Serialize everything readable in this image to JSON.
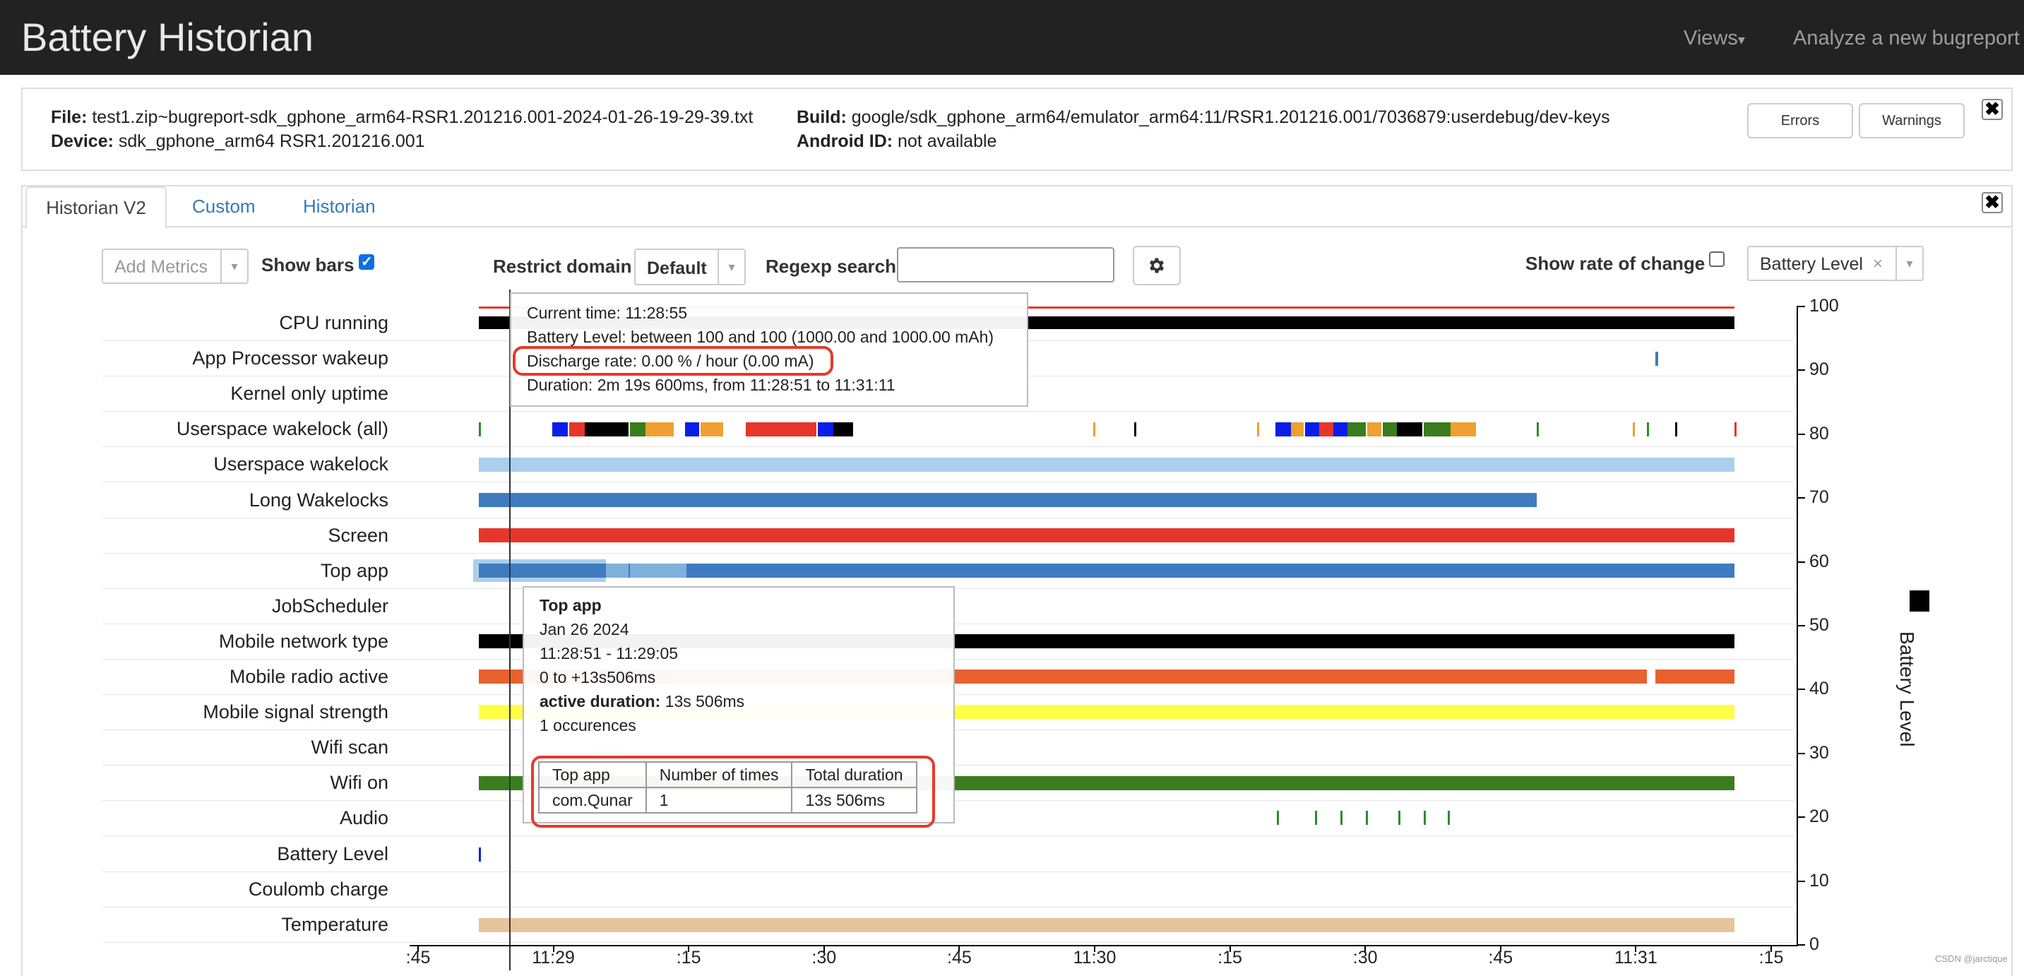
{
  "navbar": {
    "title": "Battery Historian",
    "views_label": "Views",
    "analyze_label": "Analyze a new bugreport"
  },
  "file_info": {
    "file_label": "File:",
    "file_value": "test1.zip~bugreport-sdk_gphone_arm64-RSR1.201216.001-2024-01-26-19-29-39.txt",
    "device_label": "Device:",
    "device_value": "sdk_gphone_arm64 RSR1.201216.001",
    "build_label": "Build:",
    "build_value": "google/sdk_gphone_arm64/emulator_arm64:11/RSR1.201216.001/7036879:userdebug/dev-keys",
    "android_id_label": "Android ID:",
    "android_id_value": "not available",
    "errors_label": "Errors",
    "warnings_label": "Warnings",
    "close_glyph": "✖"
  },
  "tabs": [
    {
      "label": "Historian V2",
      "active": true
    },
    {
      "label": "Custom",
      "active": false
    },
    {
      "label": "Historian",
      "active": false
    }
  ],
  "controls": {
    "add_metrics_placeholder": "Add Metrics",
    "show_bars_label": "Show bars",
    "show_bars_checked": true,
    "restrict_domain_label": "Restrict domain",
    "restrict_domain_value": "Default",
    "regexp_label": "Regexp search",
    "regexp_value": "",
    "settings_icon": "gear-icon",
    "show_rate_label": "Show rate of change",
    "show_rate_checked": false,
    "battery_select_value": "Battery Level",
    "battery_select_clear": "×",
    "caret": "▾"
  },
  "rows": [
    "CPU running",
    "App Processor wakeup",
    "Kernel only uptime",
    "Userspace wakelock (all)",
    "Userspace wakelock",
    "Long Wakelocks",
    "Screen",
    "Top app",
    "JobScheduler",
    "Mobile network type",
    "Mobile radio active",
    "Mobile signal strength",
    "Wifi scan",
    "Wifi on",
    "Audio",
    "Battery Level",
    "Coulomb charge",
    "Temperature"
  ],
  "y_axis": {
    "label": "Battery Level",
    "ticks": [
      "100",
      "90",
      "80",
      "70",
      "60",
      "50",
      "40",
      "30",
      "20",
      "10",
      "0"
    ]
  },
  "x_axis": {
    "ticks": [
      ":45",
      "11:29",
      ":15",
      ":30",
      ":45",
      "11:30",
      ":15",
      ":30",
      ":45",
      "11:31",
      ":15"
    ]
  },
  "colors": {
    "cpu": "#000000",
    "screen": "#e8352a",
    "top_app": "#3f7bbf",
    "userspace_wakelock": "#a9cfec",
    "long_wakelocks": "#3f7bbf",
    "mobile_radio": "#e8612f",
    "signal": "#ffff44",
    "wifi_on": "#3a7d1e",
    "temperature": "#e8c49c",
    "battery_line": "#e53a2a",
    "highlight": "#e53a2a"
  },
  "tooltip_battery": {
    "current_time": "Current time: 11:28:55",
    "battery_level": "Battery Level: between 100 and 100 (1000.00 and 1000.00 mAh)",
    "discharge_rate": "Discharge rate: 0.00 % / hour (0.00 mA)",
    "duration": "Duration: 2m 19s 600ms, from 11:28:51 to 11:31:11"
  },
  "tooltip_topapp": {
    "title": "Top app",
    "date": "Jan 26 2024",
    "time_range": "11:28:51 - 11:29:05",
    "offset": "0 to +13s506ms",
    "active_label": "active duration:",
    "active_value": "13s 506ms",
    "occurrences": "1 occurences",
    "table_headers": [
      "Top app",
      "Number of times",
      "Total duration"
    ],
    "table_rows": [
      [
        "com.Qunar",
        "1",
        "13s 506ms"
      ]
    ]
  },
  "watermark": "CSDN @jarctique"
}
